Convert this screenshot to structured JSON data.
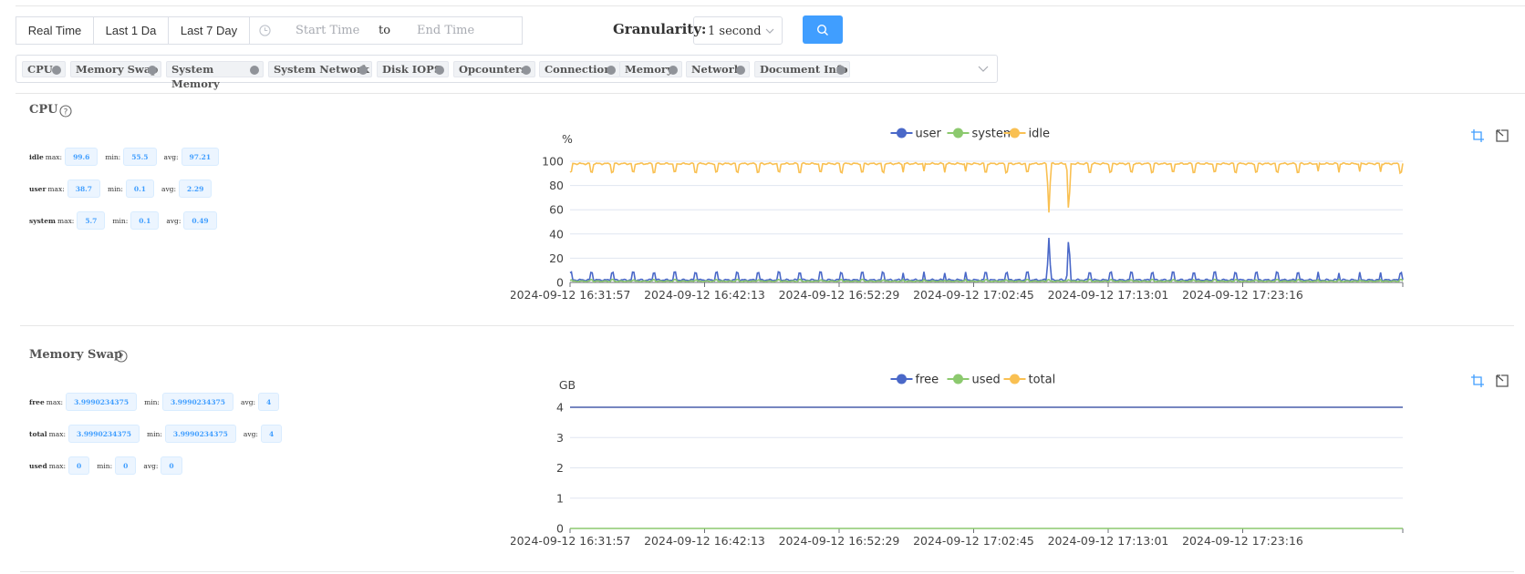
{
  "toolbar": {
    "range_buttons": [
      "Real Time",
      "Last 1 Da",
      "Last 7 Day"
    ],
    "start_placeholder": "Start Time",
    "separator": "to",
    "end_placeholder": "End Time",
    "granularity_label": "Granularity:",
    "granularity_value": "1 second"
  },
  "tags": [
    "CPU",
    "Memory Swap",
    "System Memory",
    "System Network",
    "Disk IOPS",
    "Opcounters",
    "Connection",
    "Memory",
    "Network",
    "Document Info"
  ],
  "cpu": {
    "title": "CPU",
    "stats": [
      {
        "name": "idle",
        "max": "99.6",
        "min": "55.5",
        "avg": "97.21"
      },
      {
        "name": "user",
        "max": "38.7",
        "min": "0.1",
        "avg": "2.29"
      },
      {
        "name": "system",
        "max": "5.7",
        "min": "0.1",
        "avg": "0.49"
      }
    ]
  },
  "swap": {
    "title": "Memory Swap",
    "stats": [
      {
        "name": "free",
        "max": "3.9990234375",
        "min": "3.9990234375",
        "avg": "4"
      },
      {
        "name": "total",
        "max": "3.9990234375",
        "min": "3.9990234375",
        "avg": "4"
      },
      {
        "name": "used",
        "max": "0",
        "min": "0",
        "avg": "0"
      }
    ]
  },
  "labels": {
    "max": "max:",
    "min": "min:",
    "avg": "avg:"
  },
  "colors": {
    "user": "#4a68c8",
    "system": "#8cc96e",
    "idle": "#f9c052",
    "free": "#4a68c8",
    "used": "#8cc96e",
    "total": "#f9c052",
    "accent": "#409eff"
  },
  "chart_data": [
    {
      "type": "line",
      "title": "CPU",
      "ylabel": "%",
      "ylim": [
        0,
        100
      ],
      "yticks": [
        0,
        20,
        40,
        60,
        80,
        100
      ],
      "x_ticks": [
        "2024-09-12 16:31:57",
        "2024-09-12 16:42:13",
        "2024-09-12 16:52:29",
        "2024-09-12 17:02:45",
        "2024-09-12 17:13:01",
        "2024-09-12 17:23:16"
      ],
      "legend": "top-center",
      "grid": true,
      "series": [
        {
          "name": "user",
          "baseline": 2,
          "spike_level": 8,
          "max": 38.7,
          "max_at": [
            "17:08:30",
            "17:10:00"
          ]
        },
        {
          "name": "system",
          "baseline": 0.5,
          "max": 5.7
        },
        {
          "name": "idle",
          "baseline": 98,
          "dip_level": 91,
          "min": 55.5,
          "min_at": [
            "17:08:30",
            "17:10:00"
          ]
        }
      ]
    },
    {
      "type": "line",
      "title": "Memory Swap",
      "ylabel": "GB",
      "ylim": [
        0,
        4
      ],
      "yticks": [
        0,
        1,
        2,
        3,
        4
      ],
      "x_ticks": [
        "2024-09-12 16:31:57",
        "2024-09-12 16:42:13",
        "2024-09-12 16:52:29",
        "2024-09-12 17:02:45",
        "2024-09-12 17:13:01",
        "2024-09-12 17:23:16"
      ],
      "legend": "top-center",
      "grid": true,
      "series": [
        {
          "name": "free",
          "constant": 3.9990234375
        },
        {
          "name": "used",
          "constant": 0
        },
        {
          "name": "total",
          "constant": 3.9990234375
        }
      ]
    }
  ]
}
